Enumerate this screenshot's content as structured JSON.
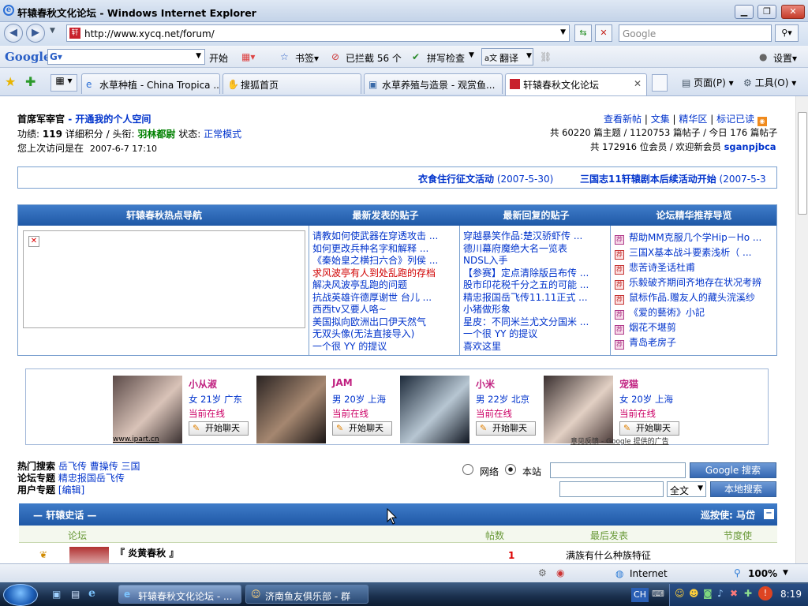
{
  "window": {
    "title": "轩辕春秋文化论坛 - Windows Internet Explorer"
  },
  "address": {
    "url": "http://www.xycq.net/forum/",
    "search_placeholder": "Google"
  },
  "gtoolbar": {
    "logo": "Google",
    "go": "开始",
    "bookmarks": "书签▾",
    "blocked": "已拦截 56 个",
    "spell": "拼写检查",
    "translate": "翻译",
    "settings": "设置▾"
  },
  "tabs": [
    {
      "label": "水草种植 - China Tropica ..."
    },
    {
      "label": "搜狐首页"
    },
    {
      "label": "水草养殖与造景 - 观赏鱼..."
    },
    {
      "label": "轩辕春秋文化论坛"
    }
  ],
  "cmd": {
    "page": "页面(P)",
    "tools": "工具(O)"
  },
  "user": {
    "rank": "首席军宰官",
    "space_link": "- 开通我的个人空间",
    "merit_label": "功绩:",
    "merit_value": "119",
    "detail_link": "详细积分",
    "title_label": "/ 头衔:",
    "title_value": "羽林都尉",
    "status_label": "状态:",
    "status_value": "正常模式",
    "last_visit_label": "您上次访问是在",
    "last_visit": "2007-6-7 17:10"
  },
  "toplinks": [
    "查看新帖",
    "文集",
    "精华区",
    "标记已读"
  ],
  "stats": {
    "line1": "共 60220 篇主题 / 1120753 篇帖子 / 今日 176 篇帖子",
    "line2": "共 172916 位会员 / 欢迎新会员",
    "newmember": "sganpjbca"
  },
  "marquee": [
    {
      "title": "衣食住行征文活动",
      "date": "(2007-5-30)"
    },
    {
      "title": "三国志11轩辕剧本后续活动开始",
      "date": "(2007-5-3"
    }
  ],
  "nav": {
    "headers": [
      "轩辕春秋热点导航",
      "最新发表的贴子",
      "最新回复的贴子",
      "论坛精华推荐导览"
    ],
    "latest_posts": [
      "请教如何使武器在穿透攻击 ...",
      "如何更改兵种名字和解释 ...",
      "《秦始皇之横扫六合》列侯 ...",
      "求风波亭有人到处乱跑的存档",
      "解决风波亭乱跑的问题",
      "抗战英雄许德厚谢世 台儿 ...",
      "西西tv又要人咯~",
      "美国拟向欧洲出口伊天然气",
      "无双头像(无法直接导入)",
      "一个很 YY 的提议"
    ],
    "latest_replies": [
      "穿越暴笑作品:楚汉骄虾传 ...",
      "德川幕府魔绝大名一览表",
      "NDSL入手",
      "【参赛】定点清除版吕布传 ...",
      "股市印花税千分之五的可能 ...",
      "精忠报国岳飞传11.11正式 ...",
      "小猪做形象",
      "星皮：不同米兰尤文分国米 ...",
      "一个很 YY 的提议",
      "喜欢这里"
    ],
    "featured": [
      "帮助MM克服几个学Hip－Ho ...",
      "三国X基本战斗要素浅析（ ...",
      "悲苦诗圣话杜甫",
      "乐毅破齐期间齐地存在状况考辨",
      "鼠标作品.赠友人的藏头浣溪纱",
      "《爱的藝術》小記",
      "烟花不堪剪",
      "青岛老房子"
    ],
    "featured_badge": "荐"
  },
  "profiles": [
    {
      "name": "小从淑",
      "gender": "女",
      "age": "21岁",
      "city": "广东",
      "status": "当前在线",
      "chat": "开始聊天"
    },
    {
      "name": "JAM",
      "gender": "男",
      "age": "20岁",
      "city": "上海",
      "status": "当前在线",
      "chat": "开始聊天"
    },
    {
      "name": "小米",
      "gender": "男",
      "age": "22岁",
      "city": "北京",
      "status": "当前在线",
      "chat": "开始聊天"
    },
    {
      "name": "宠猫",
      "gender": "女",
      "age": "20岁",
      "city": "上海",
      "status": "当前在线",
      "chat": "开始聊天"
    }
  ],
  "ad_source": "www.ipart.cn",
  "ad_google": "意见反馈 - Google 提供的广告",
  "search": {
    "hot_label": "热门搜索",
    "hot": [
      "岳飞传",
      "曹操传",
      "三国"
    ],
    "topic_label": "论坛专题",
    "topic": "精忠报国岳飞传",
    "user_label": "用户专题",
    "user_edit": "[编辑]",
    "radio_web": "网络",
    "radio_site": "本站",
    "google_btn": "Google 搜索",
    "scope": "全文",
    "local_btn": "本地搜索"
  },
  "section": {
    "title": "轩辕史话",
    "patrol": "巡按使: 马岱",
    "cols": [
      "论坛",
      "帖数",
      "最后发表",
      "节度使"
    ],
    "row_title": "『 炎黄春秋 』",
    "row_count": "1",
    "row_last": "满族有什么种族特征"
  },
  "status": {
    "zone": "Internet",
    "zoom": "100%"
  },
  "taskbar": {
    "tasks": [
      "轩辕春秋文化论坛 - ...",
      "济南鱼友俱乐部 - 群"
    ],
    "lang": "CH",
    "clock": "8:19"
  }
}
